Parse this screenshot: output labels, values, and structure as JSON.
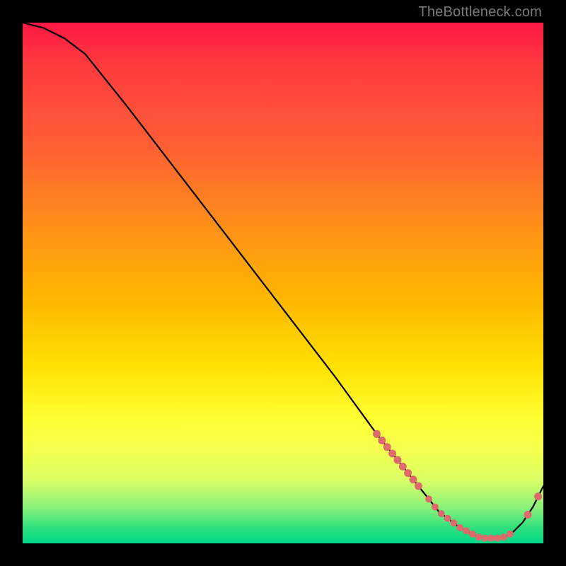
{
  "watermark": "TheBottleneck.com",
  "chart_data": {
    "type": "line",
    "title": "",
    "xlabel": "",
    "ylabel": "",
    "xlim": [
      0,
      100
    ],
    "ylim": [
      0,
      100
    ],
    "grid": false,
    "legend": false,
    "series": [
      {
        "name": "curve",
        "x": [
          0,
          4,
          8,
          12,
          20,
          30,
          40,
          50,
          60,
          68,
          72,
          76,
          80,
          84,
          88,
          92,
          94,
          96,
          98,
          100
        ],
        "y": [
          100,
          99,
          97,
          94,
          84,
          71,
          58,
          45,
          32,
          21,
          16,
          11,
          6,
          3,
          1,
          1,
          2,
          4,
          7,
          11
        ]
      }
    ],
    "annotations": [
      {
        "type": "marker-cluster",
        "approx_x_range": [
          68,
          76
        ],
        "approx_y_range": [
          14,
          23
        ],
        "color": "#e06a6a"
      },
      {
        "type": "marker-cluster",
        "approx_x_range": [
          78,
          94
        ],
        "approx_y_range": [
          0,
          3
        ],
        "color": "#e06a6a"
      },
      {
        "type": "marker-pair",
        "approx_x_range": [
          97,
          99
        ],
        "approx_y_range": [
          6,
          10
        ],
        "color": "#e06a6a"
      }
    ]
  }
}
